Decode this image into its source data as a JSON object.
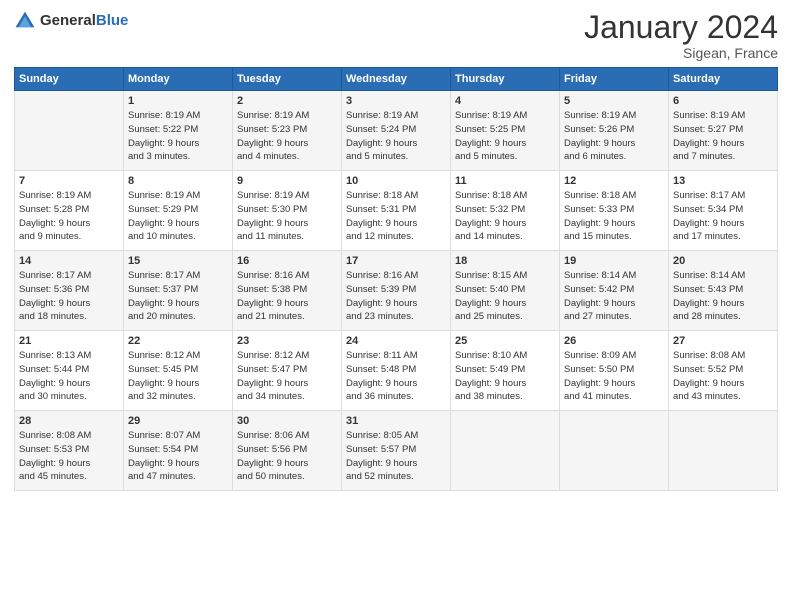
{
  "logo": {
    "text_general": "General",
    "text_blue": "Blue"
  },
  "title": {
    "month": "January 2024",
    "location": "Sigean, France"
  },
  "headers": [
    "Sunday",
    "Monday",
    "Tuesday",
    "Wednesday",
    "Thursday",
    "Friday",
    "Saturday"
  ],
  "weeks": [
    [
      {
        "day": "",
        "sunrise": "",
        "sunset": "",
        "daylight": ""
      },
      {
        "day": "1",
        "sunrise": "Sunrise: 8:19 AM",
        "sunset": "Sunset: 5:22 PM",
        "daylight": "Daylight: 9 hours and 3 minutes."
      },
      {
        "day": "2",
        "sunrise": "Sunrise: 8:19 AM",
        "sunset": "Sunset: 5:23 PM",
        "daylight": "Daylight: 9 hours and 4 minutes."
      },
      {
        "day": "3",
        "sunrise": "Sunrise: 8:19 AM",
        "sunset": "Sunset: 5:24 PM",
        "daylight": "Daylight: 9 hours and 5 minutes."
      },
      {
        "day": "4",
        "sunrise": "Sunrise: 8:19 AM",
        "sunset": "Sunset: 5:25 PM",
        "daylight": "Daylight: 9 hours and 5 minutes."
      },
      {
        "day": "5",
        "sunrise": "Sunrise: 8:19 AM",
        "sunset": "Sunset: 5:26 PM",
        "daylight": "Daylight: 9 hours and 6 minutes."
      },
      {
        "day": "6",
        "sunrise": "Sunrise: 8:19 AM",
        "sunset": "Sunset: 5:27 PM",
        "daylight": "Daylight: 9 hours and 7 minutes."
      }
    ],
    [
      {
        "day": "7",
        "sunrise": "Sunrise: 8:19 AM",
        "sunset": "Sunset: 5:28 PM",
        "daylight": "Daylight: 9 hours and 9 minutes."
      },
      {
        "day": "8",
        "sunrise": "Sunrise: 8:19 AM",
        "sunset": "Sunset: 5:29 PM",
        "daylight": "Daylight: 9 hours and 10 minutes."
      },
      {
        "day": "9",
        "sunrise": "Sunrise: 8:19 AM",
        "sunset": "Sunset: 5:30 PM",
        "daylight": "Daylight: 9 hours and 11 minutes."
      },
      {
        "day": "10",
        "sunrise": "Sunrise: 8:18 AM",
        "sunset": "Sunset: 5:31 PM",
        "daylight": "Daylight: 9 hours and 12 minutes."
      },
      {
        "day": "11",
        "sunrise": "Sunrise: 8:18 AM",
        "sunset": "Sunset: 5:32 PM",
        "daylight": "Daylight: 9 hours and 14 minutes."
      },
      {
        "day": "12",
        "sunrise": "Sunrise: 8:18 AM",
        "sunset": "Sunset: 5:33 PM",
        "daylight": "Daylight: 9 hours and 15 minutes."
      },
      {
        "day": "13",
        "sunrise": "Sunrise: 8:17 AM",
        "sunset": "Sunset: 5:34 PM",
        "daylight": "Daylight: 9 hours and 17 minutes."
      }
    ],
    [
      {
        "day": "14",
        "sunrise": "Sunrise: 8:17 AM",
        "sunset": "Sunset: 5:36 PM",
        "daylight": "Daylight: 9 hours and 18 minutes."
      },
      {
        "day": "15",
        "sunrise": "Sunrise: 8:17 AM",
        "sunset": "Sunset: 5:37 PM",
        "daylight": "Daylight: 9 hours and 20 minutes."
      },
      {
        "day": "16",
        "sunrise": "Sunrise: 8:16 AM",
        "sunset": "Sunset: 5:38 PM",
        "daylight": "Daylight: 9 hours and 21 minutes."
      },
      {
        "day": "17",
        "sunrise": "Sunrise: 8:16 AM",
        "sunset": "Sunset: 5:39 PM",
        "daylight": "Daylight: 9 hours and 23 minutes."
      },
      {
        "day": "18",
        "sunrise": "Sunrise: 8:15 AM",
        "sunset": "Sunset: 5:40 PM",
        "daylight": "Daylight: 9 hours and 25 minutes."
      },
      {
        "day": "19",
        "sunrise": "Sunrise: 8:14 AM",
        "sunset": "Sunset: 5:42 PM",
        "daylight": "Daylight: 9 hours and 27 minutes."
      },
      {
        "day": "20",
        "sunrise": "Sunrise: 8:14 AM",
        "sunset": "Sunset: 5:43 PM",
        "daylight": "Daylight: 9 hours and 28 minutes."
      }
    ],
    [
      {
        "day": "21",
        "sunrise": "Sunrise: 8:13 AM",
        "sunset": "Sunset: 5:44 PM",
        "daylight": "Daylight: 9 hours and 30 minutes."
      },
      {
        "day": "22",
        "sunrise": "Sunrise: 8:12 AM",
        "sunset": "Sunset: 5:45 PM",
        "daylight": "Daylight: 9 hours and 32 minutes."
      },
      {
        "day": "23",
        "sunrise": "Sunrise: 8:12 AM",
        "sunset": "Sunset: 5:47 PM",
        "daylight": "Daylight: 9 hours and 34 minutes."
      },
      {
        "day": "24",
        "sunrise": "Sunrise: 8:11 AM",
        "sunset": "Sunset: 5:48 PM",
        "daylight": "Daylight: 9 hours and 36 minutes."
      },
      {
        "day": "25",
        "sunrise": "Sunrise: 8:10 AM",
        "sunset": "Sunset: 5:49 PM",
        "daylight": "Daylight: 9 hours and 38 minutes."
      },
      {
        "day": "26",
        "sunrise": "Sunrise: 8:09 AM",
        "sunset": "Sunset: 5:50 PM",
        "daylight": "Daylight: 9 hours and 41 minutes."
      },
      {
        "day": "27",
        "sunrise": "Sunrise: 8:08 AM",
        "sunset": "Sunset: 5:52 PM",
        "daylight": "Daylight: 9 hours and 43 minutes."
      }
    ],
    [
      {
        "day": "28",
        "sunrise": "Sunrise: 8:08 AM",
        "sunset": "Sunset: 5:53 PM",
        "daylight": "Daylight: 9 hours and 45 minutes."
      },
      {
        "day": "29",
        "sunrise": "Sunrise: 8:07 AM",
        "sunset": "Sunset: 5:54 PM",
        "daylight": "Daylight: 9 hours and 47 minutes."
      },
      {
        "day": "30",
        "sunrise": "Sunrise: 8:06 AM",
        "sunset": "Sunset: 5:56 PM",
        "daylight": "Daylight: 9 hours and 50 minutes."
      },
      {
        "day": "31",
        "sunrise": "Sunrise: 8:05 AM",
        "sunset": "Sunset: 5:57 PM",
        "daylight": "Daylight: 9 hours and 52 minutes."
      },
      {
        "day": "",
        "sunrise": "",
        "sunset": "",
        "daylight": ""
      },
      {
        "day": "",
        "sunrise": "",
        "sunset": "",
        "daylight": ""
      },
      {
        "day": "",
        "sunrise": "",
        "sunset": "",
        "daylight": ""
      }
    ]
  ]
}
